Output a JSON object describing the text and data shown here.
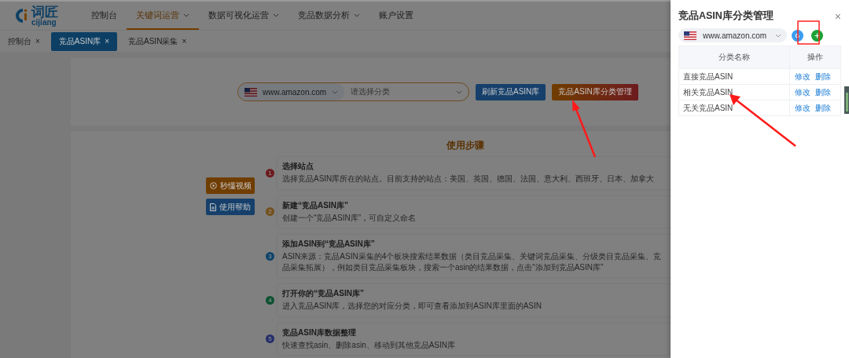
{
  "header": {
    "logo": {
      "text": "词匠",
      "subtext": "cijiang"
    },
    "nav": [
      {
        "label": "控制台",
        "selected": false,
        "dropdown": false
      },
      {
        "label": "关键词运营",
        "selected": true,
        "dropdown": true
      },
      {
        "label": "数据可视化运营",
        "selected": false,
        "dropdown": true
      },
      {
        "label": "竞品数据分析",
        "selected": false,
        "dropdown": true
      },
      {
        "label": "账户设置",
        "selected": false,
        "dropdown": false
      }
    ]
  },
  "tabs": [
    {
      "label": "控制台",
      "close": "×",
      "selected": false
    },
    {
      "label": "竞品ASIN库",
      "close": "×",
      "selected": true
    },
    {
      "label": "竞品ASIN采集",
      "close": "×",
      "selected": false
    }
  ],
  "search": {
    "site": "www.amazon.com",
    "category_placeholder": "请选择分类",
    "buttons": [
      {
        "label": "刷新竞品ASIN库",
        "kind": "primary"
      },
      {
        "label": "竞品ASIN库分类管理",
        "kind": "warning"
      }
    ]
  },
  "guide": {
    "title": "使用步骤",
    "buttons": [
      {
        "label": "秒懂视频",
        "kind": "video"
      },
      {
        "label": "使用帮助",
        "kind": "help"
      }
    ],
    "steps": [
      {
        "number": "1",
        "color": "#6d1b1f",
        "title": "选择站点",
        "description": "选择竞品ASIN库所在的站点。目前支持的站点：美国、英国、德国、法国、意大利、西班牙、日本、加拿大"
      },
      {
        "number": "2",
        "color": "#73511e",
        "title": "新建“竞品ASIN库”",
        "description": "创建一个“竞品ASIN库”，可自定义命名"
      },
      {
        "number": "3",
        "color": "#0f446b",
        "title": "添加ASIN到“竞品ASIN库”",
        "description": "ASIN来源：竞品ASIN采集的4个板块搜索结果数据（类目竞品采集、关键词竞品采集、分级类目竞品采集、竞品采集拓展），例如类目竞品采集板块，搜索一个asin的结果数据，点击“添加到竞品ASIN库”"
      },
      {
        "number": "4",
        "color": "#0d5130",
        "title": "打开你的“竞品ASIN库”",
        "description": "进入竞品ASIN库，选择您的对应分类，即可查看添加到ASIN库里面的ASIN"
      },
      {
        "number": "5",
        "color": "#252e6a",
        "title": "竞品ASIN库数据整理",
        "description": "快速查找asin、删除asin、移动到其他竞品ASIN库"
      }
    ]
  },
  "drawer": {
    "title": "竞品ASIN库分类管理",
    "close": "×",
    "site": "www.amazon.com",
    "table": {
      "columns": [
        "分类名称",
        "操作"
      ],
      "rows": [
        {
          "name": "直接竞品ASIN",
          "actions": [
            "修改",
            "删除"
          ]
        },
        {
          "name": "相关竞品ASIN",
          "actions": [
            "修改",
            "删除"
          ]
        },
        {
          "name": "无关竞品ASIN",
          "actions": [
            "修改",
            "删除"
          ]
        }
      ]
    }
  }
}
